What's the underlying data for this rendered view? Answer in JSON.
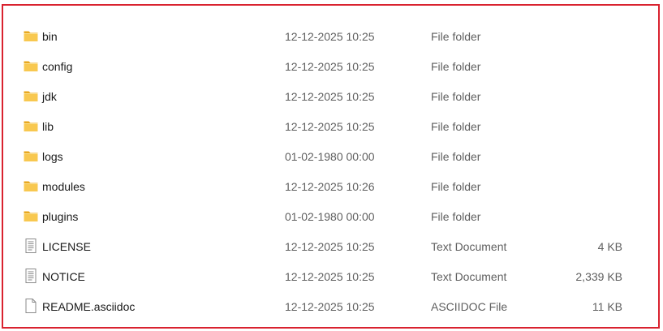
{
  "files": [
    {
      "name": "bin",
      "date": "12-12-2025 10:25",
      "type": "File folder",
      "size": "",
      "icon": "folder-icon"
    },
    {
      "name": "config",
      "date": "12-12-2025 10:25",
      "type": "File folder",
      "size": "",
      "icon": "folder-icon"
    },
    {
      "name": "jdk",
      "date": "12-12-2025 10:25",
      "type": "File folder",
      "size": "",
      "icon": "folder-icon"
    },
    {
      "name": "lib",
      "date": "12-12-2025 10:25",
      "type": "File folder",
      "size": "",
      "icon": "folder-icon"
    },
    {
      "name": "logs",
      "date": "01-02-1980 00:00",
      "type": "File folder",
      "size": "",
      "icon": "folder-icon"
    },
    {
      "name": "modules",
      "date": "12-12-2025 10:26",
      "type": "File folder",
      "size": "",
      "icon": "folder-icon"
    },
    {
      "name": "plugins",
      "date": "01-02-1980 00:00",
      "type": "File folder",
      "size": "",
      "icon": "folder-icon"
    },
    {
      "name": "LICENSE",
      "date": "12-12-2025 10:25",
      "type": "Text Document",
      "size": "4 KB",
      "icon": "text-document-icon"
    },
    {
      "name": "NOTICE",
      "date": "12-12-2025 10:25",
      "type": "Text Document",
      "size": "2,339 KB",
      "icon": "text-document-icon"
    },
    {
      "name": "README.asciidoc",
      "date": "12-12-2025 10:25",
      "type": "ASCIIDOC File",
      "size": "11 KB",
      "icon": "blank-file-icon"
    }
  ],
  "colors": {
    "frame_border": "#d9222f",
    "folder_fill": "#f8c850",
    "folder_tab": "#e8a820"
  }
}
